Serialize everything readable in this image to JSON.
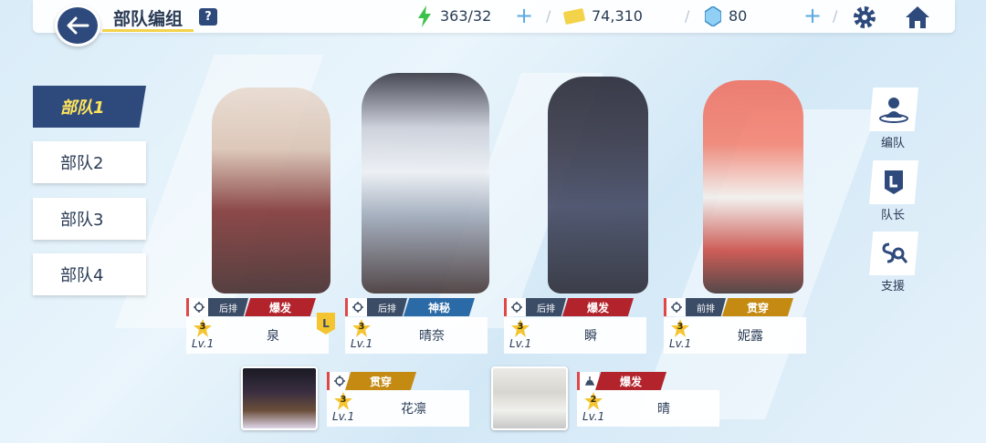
{
  "header": {
    "title": "部队编组",
    "help_label": "?",
    "ap": "363/32",
    "credits": "74,310",
    "gems": "80",
    "icons": [
      "back-arrow-icon",
      "help-icon",
      "ap-bolt-icon",
      "plus-icon",
      "credit-card-icon",
      "gem-icon",
      "gear-icon",
      "home-icon"
    ]
  },
  "squads": [
    {
      "label": "部队1",
      "active": true
    },
    {
      "label": "部队2",
      "active": false
    },
    {
      "label": "部队3",
      "active": false
    },
    {
      "label": "部队4",
      "active": false
    }
  ],
  "strikers": [
    {
      "name": "泉",
      "level": "Lv.1",
      "stars": "3",
      "row": "后排",
      "type": "爆发",
      "type_color": "#b3232c",
      "leader": "L"
    },
    {
      "name": "晴奈",
      "level": "Lv.1",
      "stars": "3",
      "row": "后排",
      "type": "神秘",
      "type_color": "#2a6aa6"
    },
    {
      "name": "瞬",
      "level": "Lv.1",
      "stars": "3",
      "row": "后排",
      "type": "爆发",
      "type_color": "#b3232c"
    },
    {
      "name": "妮露",
      "level": "Lv.1",
      "stars": "3",
      "row": "前排",
      "type": "贯穿",
      "type_color": "#c48a12"
    }
  ],
  "specials": [
    {
      "name": "花凛",
      "level": "Lv.1",
      "stars": "3",
      "type": "贯穿",
      "type_color": "#c48a12"
    },
    {
      "name": "晴",
      "level": "Lv.1",
      "stars": "2",
      "type": "爆发",
      "type_color": "#b3232c"
    }
  ],
  "side_menu": [
    {
      "label": "编队",
      "icon": "formation-icon"
    },
    {
      "label": "队长",
      "icon": "leader-icon"
    },
    {
      "label": "支援",
      "icon": "support-search-icon"
    }
  ],
  "colors": {
    "accent": "#2e4a7c",
    "tab_active_text": "#ffe45c",
    "explosive": "#b3232c",
    "mystic": "#2a6aa6",
    "piercing": "#c48a12"
  }
}
